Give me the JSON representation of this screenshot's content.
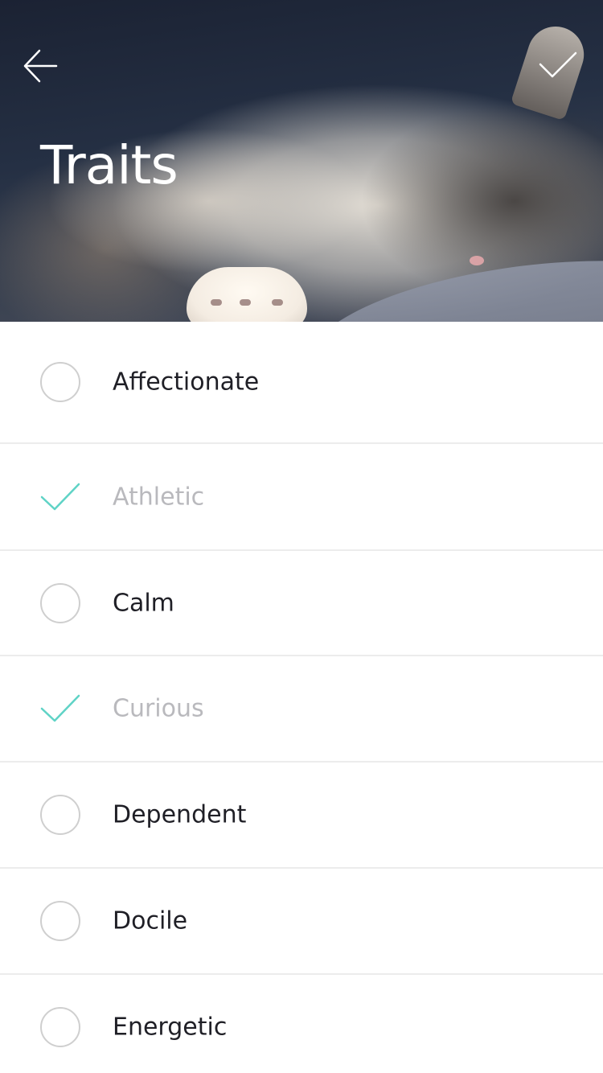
{
  "header": {
    "title": "Traits",
    "back_icon": "arrow-left-icon",
    "done_icon": "checkmark-icon"
  },
  "colors": {
    "accent": "#5fd3c6",
    "text": "#1f1f26",
    "muted_text": "#b9b9bd",
    "divider": "#ececec",
    "radio_border": "#cfcfcf"
  },
  "traits": [
    {
      "label": "Affectionate",
      "selected": false
    },
    {
      "label": "Athletic",
      "selected": true
    },
    {
      "label": "Calm",
      "selected": false
    },
    {
      "label": "Curious",
      "selected": true
    },
    {
      "label": "Dependent",
      "selected": false
    },
    {
      "label": "Docile",
      "selected": false
    },
    {
      "label": "Energetic",
      "selected": false
    }
  ]
}
